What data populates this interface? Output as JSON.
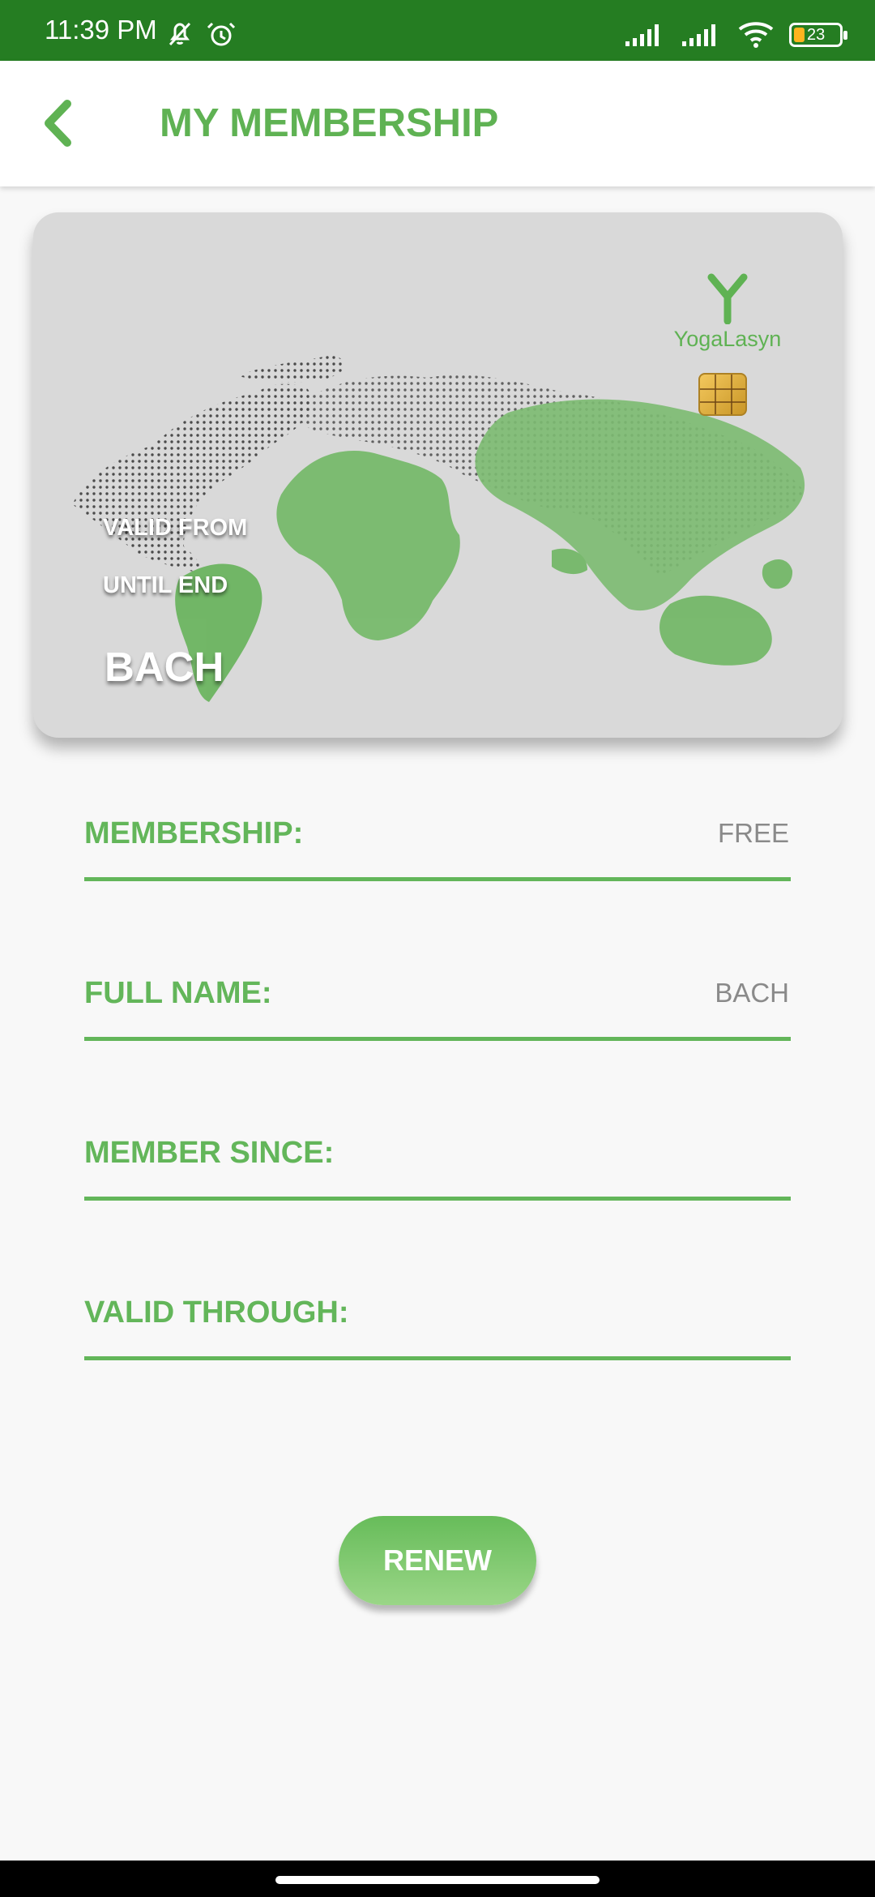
{
  "status": {
    "time": "11:39 PM",
    "battery": "23"
  },
  "header": {
    "title": "MY MEMBERSHIP",
    "back_icon": "chevron-left-icon"
  },
  "card": {
    "brand": "YogaLasyn",
    "valid_from": "VALID FROM",
    "until_end": "UNTIL END",
    "holder_name": "BACH",
    "accent_color": "#5fb253",
    "background_color": "#d9d9d9"
  },
  "fields": {
    "membership": {
      "label": "MEMBERSHIP:",
      "value": "FREE"
    },
    "full_name": {
      "label": "FULL NAME:",
      "value": "BACH"
    },
    "member_since": {
      "label": "MEMBER SINCE:",
      "value": ""
    },
    "valid_through": {
      "label": "VALID THROUGH:",
      "value": ""
    }
  },
  "actions": {
    "renew": "RENEW"
  },
  "colors": {
    "status_bar": "#257d22",
    "primary_green": "#63b65a",
    "value_gray": "#8a8a8a"
  }
}
